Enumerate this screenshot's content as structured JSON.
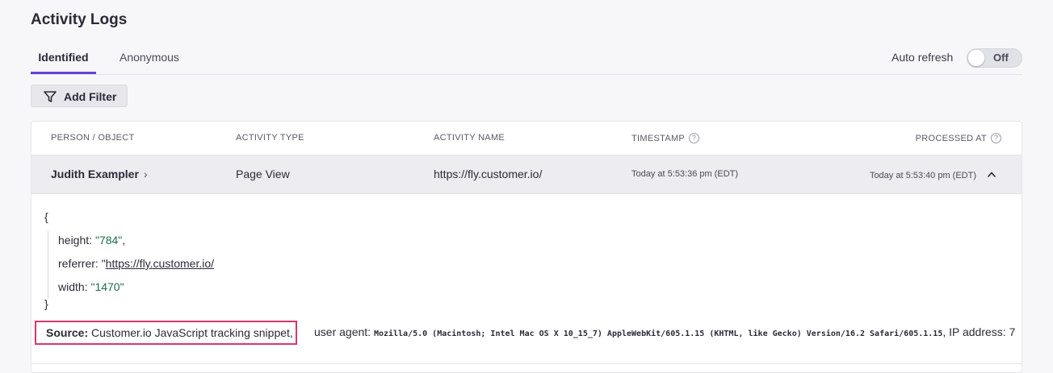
{
  "page": {
    "title": "Activity Logs"
  },
  "tabs": [
    {
      "label": "Identified",
      "active": true
    },
    {
      "label": "Anonymous",
      "active": false
    }
  ],
  "auto_refresh": {
    "label": "Auto refresh",
    "state": "Off"
  },
  "filter": {
    "add_label": "Add Filter"
  },
  "table": {
    "headers": {
      "person": "PERSON / OBJECT",
      "type": "ACTIVITY TYPE",
      "name": "ACTIVITY NAME",
      "timestamp": "TIMESTAMP",
      "processed": "PROCESSED AT"
    },
    "row": {
      "person": "Judith Exampler",
      "type": "Page View",
      "name": "https://fly.customer.io/",
      "timestamp": "Today at 5:53:36 pm (EDT)",
      "processed": "Today at 5:53:40 pm (EDT)"
    },
    "detail": {
      "open_brace": "{",
      "close_brace": "}",
      "height_key": "height: ",
      "height_val": "\"784\"",
      "referrer_key": "referrer: \"",
      "referrer_val": "https://fly.customer.io/",
      "width_key": "width: ",
      "width_val": "\"1470\"",
      "source_label": "Source:",
      "source_value": " Customer.io JavaScript tracking snippet,",
      "ua_label": "user agent: ",
      "ua_value": "Mozilla/5.0 (Macintosh; Intel Mac OS X 10_15_7) AppleWebKit/605.1.15 (KHTML, like Gecko) Version/16.2 Safari/605.1.15",
      "ip_label": ", IP address: 7"
    }
  },
  "colors": {
    "accent": "#6b3fd6",
    "highlight": "#d9366e",
    "string": "#1e6b47"
  }
}
